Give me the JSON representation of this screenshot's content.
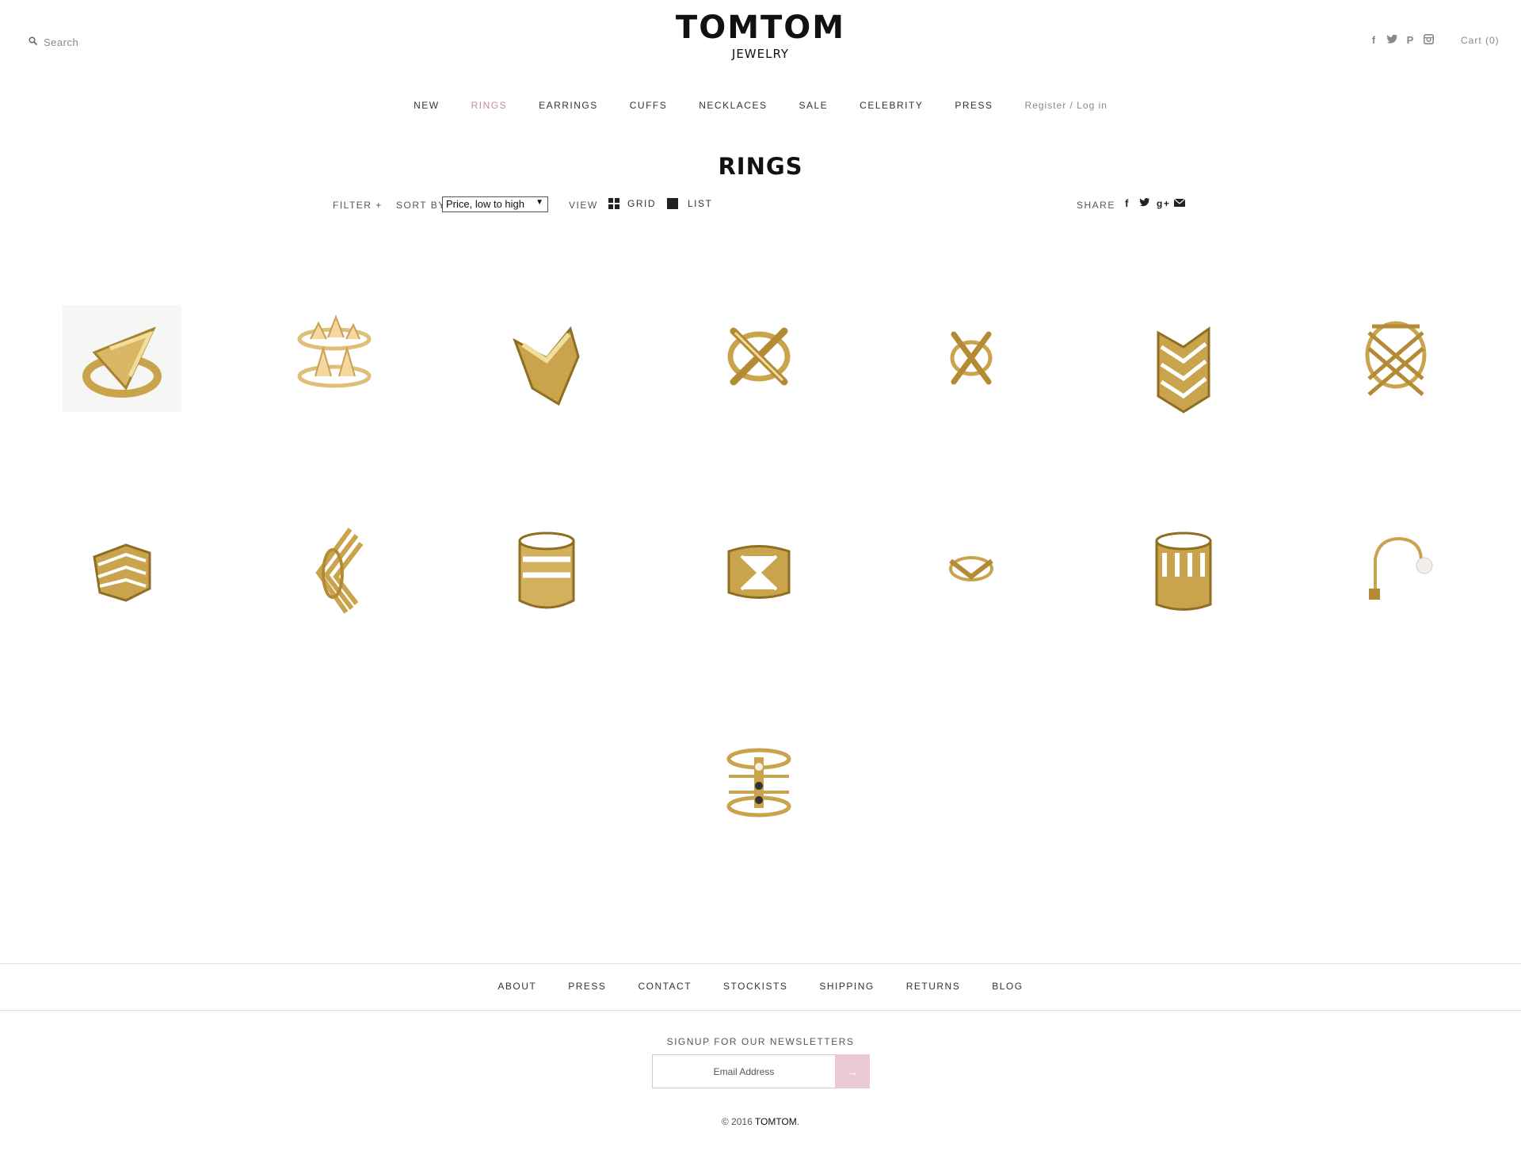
{
  "header": {
    "search_placeholder": "Search",
    "logo_brand": "TOMTOM",
    "logo_sub": "JEWELRY",
    "social": [
      "facebook-icon",
      "twitter-icon",
      "pinterest-icon",
      "instagram-icon"
    ],
    "cart_label": "Cart (0)"
  },
  "nav": {
    "items": [
      "NEW",
      "RINGS",
      "EARRINGS",
      "CUFFS",
      "NECKLACES",
      "SALE",
      "CELEBRITY",
      "PRESS"
    ],
    "active": "RINGS",
    "active_color": "#c48c98",
    "login_label": "Register / Log in"
  },
  "page": {
    "title": "RINGS"
  },
  "toolbar": {
    "filter_label": "FILTER +",
    "sort_label": "SORT BY",
    "sort_value": "Price, low to high",
    "view_label": "VIEW",
    "grid_label": "GRID",
    "list_label": "LIST",
    "share_label": "SHARE",
    "share_icons": [
      "facebook-icon",
      "twitter-icon",
      "google-plus-icon",
      "email-icon"
    ]
  },
  "products": {
    "count": 15,
    "items": [
      {
        "kind": "chevron-ring"
      },
      {
        "kind": "spike-double-ring"
      },
      {
        "kind": "shield-ring"
      },
      {
        "kind": "x-ring"
      },
      {
        "kind": "small-x-ring"
      },
      {
        "kind": "triple-chevron-ring"
      },
      {
        "kind": "crisscross-ring"
      },
      {
        "kind": "stacked-chevron-ring"
      },
      {
        "kind": "angled-chevron-ring"
      },
      {
        "kind": "cutout-band-ring"
      },
      {
        "kind": "x-band-ring"
      },
      {
        "kind": "v-ring"
      },
      {
        "kind": "wide-band-ring"
      },
      {
        "kind": "open-pearl-ring"
      },
      {
        "kind": "double-stone-ring"
      }
    ],
    "gold_color": "#c9a44c"
  },
  "footer": {
    "nav": [
      "ABOUT",
      "PRESS",
      "CONTACT",
      "STOCKISTS",
      "SHIPPING",
      "RETURNS",
      "BLOG"
    ],
    "newsletter_title": "SIGNUP FOR OUR NEWSLETTERS",
    "email_placeholder": "Email Address",
    "submit_label": "→",
    "submit_color": "#e9c9d3",
    "copyright_prefix": "© 2016 ",
    "copyright_brand": "TOMTOM",
    "copyright_suffix": "."
  }
}
